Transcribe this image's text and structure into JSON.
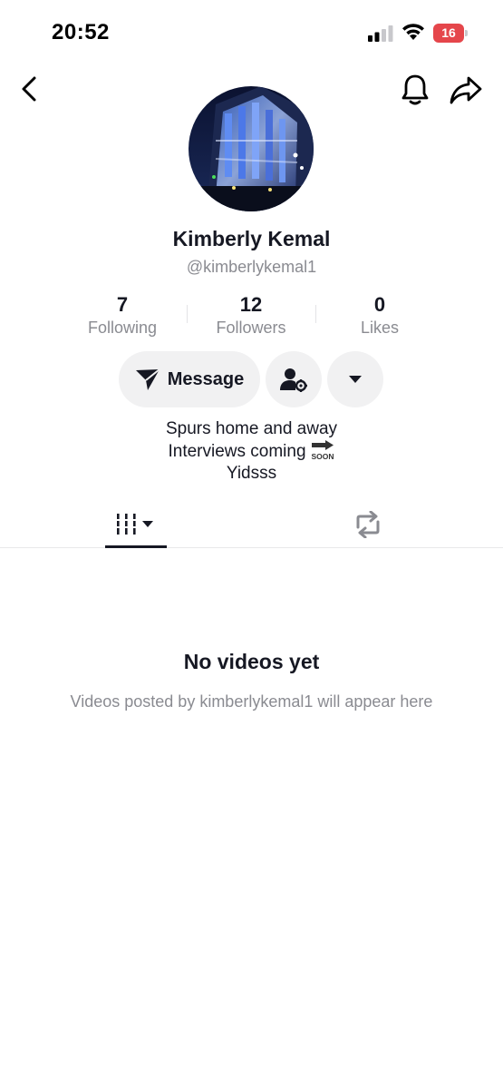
{
  "status_bar": {
    "time": "20:52",
    "battery_level": "16",
    "signal_bars_active": 2,
    "signal_bars_total": 4,
    "battery_color": "#e5464b"
  },
  "nav": {
    "back_icon": "chevron-left-icon",
    "bell_icon": "bell-icon",
    "share_icon": "share-arrow-icon"
  },
  "profile": {
    "display_name": "Kimberly Kemal",
    "handle": "@kimberlykemal1",
    "avatar_icon": "stadium-night-photo"
  },
  "stats": [
    {
      "value": "7",
      "label": "Following"
    },
    {
      "value": "12",
      "label": "Followers"
    },
    {
      "value": "0",
      "label": "Likes"
    }
  ],
  "actions": {
    "message_label": "Message",
    "message_icon": "send-icon",
    "friends_icon": "person-gear-icon",
    "more_icon": "caret-down-icon"
  },
  "bio": {
    "line1": "Spurs home and away",
    "line2": "Interviews coming",
    "line2_emoji": "soon-arrow-icon",
    "line3": "Yidsss"
  },
  "tabs": {
    "videos_icon": "grid-bars-icon",
    "reposts_icon": "repost-icon",
    "active": "videos"
  },
  "empty_state": {
    "title": "No videos yet",
    "subtitle": "Videos posted by kimberlykemal1 will appear here"
  }
}
